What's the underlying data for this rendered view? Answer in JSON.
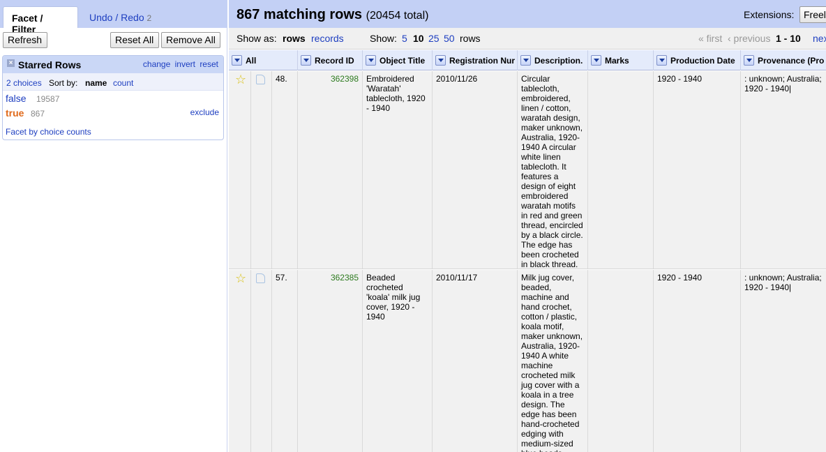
{
  "left_panel": {
    "tabs": {
      "facet_filter": "Facet / Filter",
      "undo_redo": "Undo / Redo",
      "undo_count": "2"
    },
    "buttons": {
      "refresh": "Refresh",
      "reset_all": "Reset All",
      "remove_all": "Remove All"
    },
    "facet": {
      "close_glyph": "×",
      "title": "Starred Rows",
      "links": {
        "change": "change",
        "invert": "invert",
        "reset": "reset"
      },
      "choices_count": "2 choices",
      "sort_by": "Sort by:",
      "sort_name": "name",
      "sort_count": "count",
      "choices": [
        {
          "label": "false",
          "count": "19587",
          "color": "#1d3ec0"
        },
        {
          "label": "true",
          "count": "867",
          "color": "#e06a1b",
          "selected": true
        }
      ],
      "exclude": "exclude",
      "footer": "Facet by choice counts"
    }
  },
  "right_panel": {
    "summary": {
      "matching": "867 matching rows",
      "total": "(20454 total)"
    },
    "extensions": {
      "label": "Extensions:",
      "button": "Freel"
    },
    "viewbar": {
      "show_as": "Show as:",
      "rows": "rows",
      "records": "records",
      "show": "Show:",
      "sizes": [
        "5",
        "10",
        "25",
        "50"
      ],
      "size_selected": "10",
      "rows_suffix": "rows",
      "first": "« first",
      "previous": "‹ previous",
      "range": "1 - 10",
      "next": "next"
    },
    "columns": [
      "All",
      "Record ID",
      "Object Title",
      "Registration Nur",
      "Description.",
      "Marks",
      "Production Date",
      "Provenance (Pro"
    ],
    "rows": [
      {
        "star": "☆",
        "index": "48.",
        "record_id": "362398",
        "title": "Embroidered 'Waratah' tablecloth, 1920 - 1940",
        "registration": "2010/11/26",
        "description": "Circular tablecloth, embroidered, linen / cotton, waratah design, maker unknown, Australia, 1920-1940 A circular white linen tablecloth. It features a design of eight embroidered waratah motifs in red and green thread, encircled by a black circle. The edge has been crocheted in black thread.",
        "marks": "",
        "production_date": "1920 - 1940",
        "provenance": ": unknown; Australia; 1920 - 1940|"
      },
      {
        "star": "☆",
        "index": "57.",
        "record_id": "362385",
        "title": "Beaded crocheted 'koala' milk jug cover, 1920 - 1940",
        "registration": "2010/11/17",
        "description": "Milk jug cover, beaded, machine and hand crochet, cotton / plastic, koala motif, maker unknown, Australia, 1920-1940 A white machine crocheted milk jug cover with a koala in a tree design. The edge has been hand-crocheted edging with medium-sized blue beads incorporated into",
        "marks": "",
        "production_date": "1920 - 1940",
        "provenance": ": unknown; Australia; 1920 - 1940|"
      }
    ]
  }
}
